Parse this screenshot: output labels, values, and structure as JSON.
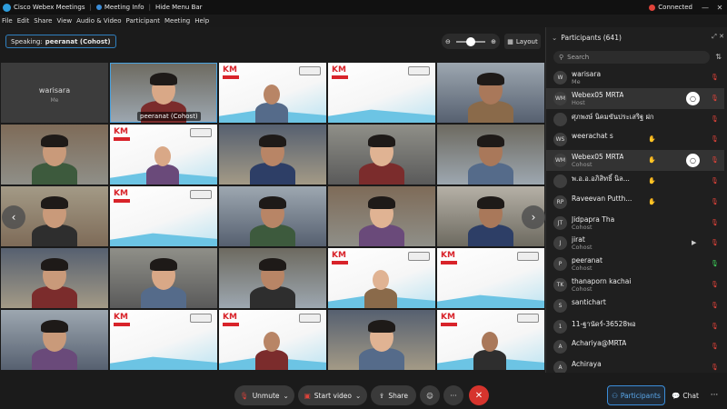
{
  "window": {
    "app_title": "Cisco Webex Meetings",
    "meeting_info": "Meeting Info",
    "hide_menu": "Hide Menu Bar",
    "status": "Connected",
    "minimize": "—",
    "close": "✕"
  },
  "menu": [
    "File",
    "Edit",
    "Share",
    "View",
    "Audio & Video",
    "Participant",
    "Meeting",
    "Help"
  ],
  "speaking": {
    "prefix": "Speaking:",
    "name": "peeranat (Cohost)"
  },
  "zoom": {
    "minus": "⊖",
    "plus": "⊕"
  },
  "layout_label": "Layout",
  "tiles": [
    {
      "kind": "name",
      "name": "warisara",
      "sub": "Me"
    },
    {
      "kind": "person",
      "label": "peeranat  (Cohost)",
      "active": true
    },
    {
      "kind": "km"
    },
    {
      "kind": "km"
    },
    {
      "kind": "person"
    },
    {
      "kind": "person"
    },
    {
      "kind": "km"
    },
    {
      "kind": "person"
    },
    {
      "kind": "person"
    },
    {
      "kind": "person"
    },
    {
      "kind": "person"
    },
    {
      "kind": "km"
    },
    {
      "kind": "person"
    },
    {
      "kind": "person"
    },
    {
      "kind": "person"
    },
    {
      "kind": "person"
    },
    {
      "kind": "person"
    },
    {
      "kind": "person"
    },
    {
      "kind": "km"
    },
    {
      "kind": "km"
    },
    {
      "kind": "person"
    },
    {
      "kind": "km"
    },
    {
      "kind": "km"
    },
    {
      "kind": "person"
    },
    {
      "kind": "km"
    }
  ],
  "nav": {
    "prev": "‹",
    "next": "›"
  },
  "panel": {
    "title": "Participants (641)",
    "search_placeholder": "Search",
    "participants": [
      {
        "initials": "W",
        "name": "warisara",
        "role": "Me",
        "mic": "off"
      },
      {
        "initials": "WM",
        "name": "Webex05 MRTA",
        "role": "Host",
        "mic": "off",
        "highlight": true,
        "menu": true
      },
      {
        "initials": "",
        "name": "ศุภพงษ์ นิคมขันประเสริฐ ฝกก",
        "role": "",
        "mic": "off"
      },
      {
        "initials": "WS",
        "name": "weerachat s",
        "role": "",
        "mic": "off",
        "hand": true
      },
      {
        "initials": "WM",
        "name": "Webex05 MRTA",
        "role": "Cohost",
        "mic": "off",
        "highlight": true,
        "menu": true,
        "hand": true
      },
      {
        "initials": "",
        "name": "พ.อ.อ.อภิสิทธิ์ นิล...",
        "role": "",
        "mic": "off",
        "hand": true
      },
      {
        "initials": "RP",
        "name": "Raveevan Putth...",
        "role": "",
        "mic": "off",
        "hand": true
      },
      {
        "initials": "JT",
        "name": "Jidpapra Tha",
        "role": "Cohost",
        "mic": "off"
      },
      {
        "initials": "J",
        "name": "jirat",
        "role": "Cohost",
        "mic": "off",
        "cam": true
      },
      {
        "initials": "P",
        "name": "peeranat",
        "role": "Cohost",
        "mic": "on"
      },
      {
        "initials": "TK",
        "name": "thanaporn kachai",
        "role": "Cohost",
        "mic": "off"
      },
      {
        "initials": "S",
        "name": "santichart",
        "role": "",
        "mic": "off"
      },
      {
        "initials": "1",
        "name": "11-ฐานัดร์-36528พอ",
        "role": "",
        "mic": "off"
      },
      {
        "initials": "A",
        "name": "Achariya@MRTA",
        "role": "",
        "mic": "off"
      },
      {
        "initials": "A",
        "name": "Achiraya",
        "role": "",
        "mic": "off"
      }
    ]
  },
  "controls": {
    "unmute": "Unmute",
    "start_video": "Start video",
    "share": "Share",
    "more": "···",
    "leave": "✕",
    "participants": "Participants",
    "chat": "Chat",
    "overflow": "···"
  },
  "colors": {
    "accent": "#3b8dd9",
    "leave": "#d6342d",
    "mic_off": "#e0433a",
    "mic_on": "#3ecf5a",
    "km_red": "#d8232a"
  }
}
